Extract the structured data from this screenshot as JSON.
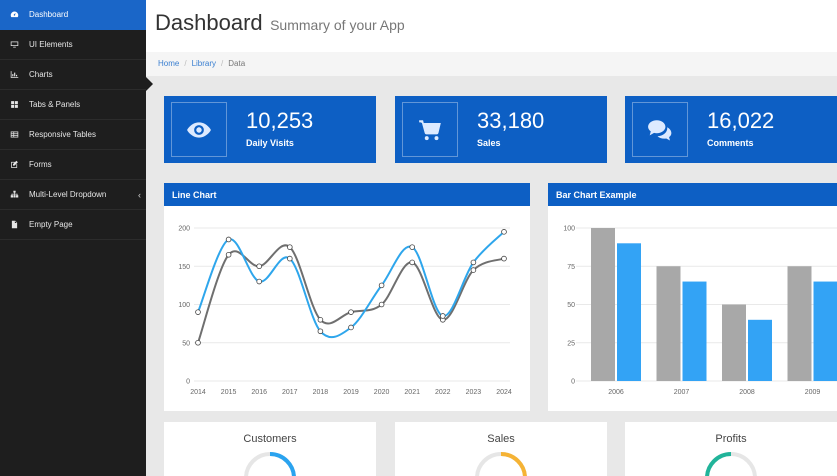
{
  "sidebar": {
    "items": [
      {
        "label": "Dashboard",
        "icon": "dashboard-icon",
        "active": true
      },
      {
        "label": "UI Elements",
        "icon": "desktop-icon"
      },
      {
        "label": "Charts",
        "icon": "bar-chart-icon"
      },
      {
        "label": "Tabs & Panels",
        "icon": "grid-icon"
      },
      {
        "label": "Responsive Tables",
        "icon": "table-icon"
      },
      {
        "label": "Forms",
        "icon": "edit-icon"
      },
      {
        "label": "Multi-Level Dropdown",
        "icon": "sitemap-icon",
        "caret": "‹"
      },
      {
        "label": "Empty Page",
        "icon": "file-icon"
      }
    ]
  },
  "header": {
    "title": "Dashboard",
    "subtitle": "Summary of your App"
  },
  "breadcrumb": {
    "items": [
      "Home",
      "Library",
      "Data"
    ],
    "sep": "/"
  },
  "stats": [
    {
      "value": "10,253",
      "label": "Daily Visits",
      "icon": "eye-icon"
    },
    {
      "value": "33,180",
      "label": "Sales",
      "icon": "cart-icon"
    },
    {
      "value": "16,022",
      "label": "Comments",
      "icon": "comments-icon"
    }
  ],
  "line_panel": {
    "title": "Line Chart"
  },
  "bar_panel": {
    "title": "Bar Chart Example"
  },
  "mini_panels": [
    {
      "title": "Customers",
      "color": "#2aa3ef"
    },
    {
      "title": "Sales",
      "color": "#f5b335"
    },
    {
      "title": "Profits",
      "color": "#21b49a"
    }
  ],
  "colors": {
    "accent": "#0d5fc4",
    "sidebar": "#1e1e1e",
    "blue_series": "#2ea6ec",
    "gray_series": "#6f6f6f",
    "gray_bar": "#a8a8a8",
    "blue_bar": "#33a3f5"
  },
  "chart_data": [
    {
      "type": "line",
      "title": "Line Chart",
      "x": [
        "2014",
        "2015",
        "2016",
        "2017",
        "2018",
        "2019",
        "2020",
        "2021",
        "2022",
        "2023",
        "2024"
      ],
      "ylim": [
        0,
        200
      ],
      "yticks": [
        0,
        50,
        100,
        150,
        200
      ],
      "grid": true,
      "series": [
        {
          "values": [
            90,
            185,
            130,
            160,
            65,
            70,
            125,
            175,
            85,
            155,
            195
          ],
          "color": "#2ea6ec"
        },
        {
          "values": [
            50,
            165,
            150,
            175,
            80,
            90,
            100,
            155,
            80,
            145,
            160
          ],
          "color": "#6f6f6f"
        }
      ]
    },
    {
      "type": "bar",
      "title": "Bar Chart Example",
      "categories": [
        "2006",
        "2007",
        "2008",
        "2009"
      ],
      "ylim": [
        0,
        100
      ],
      "yticks": [
        0,
        25,
        50,
        75,
        100
      ],
      "grid": true,
      "series": [
        {
          "values": [
            100,
            75,
            50,
            75
          ],
          "color": "#a8a8a8"
        },
        {
          "values": [
            90,
            65,
            40,
            65
          ],
          "color": "#33a3f5"
        }
      ]
    }
  ]
}
